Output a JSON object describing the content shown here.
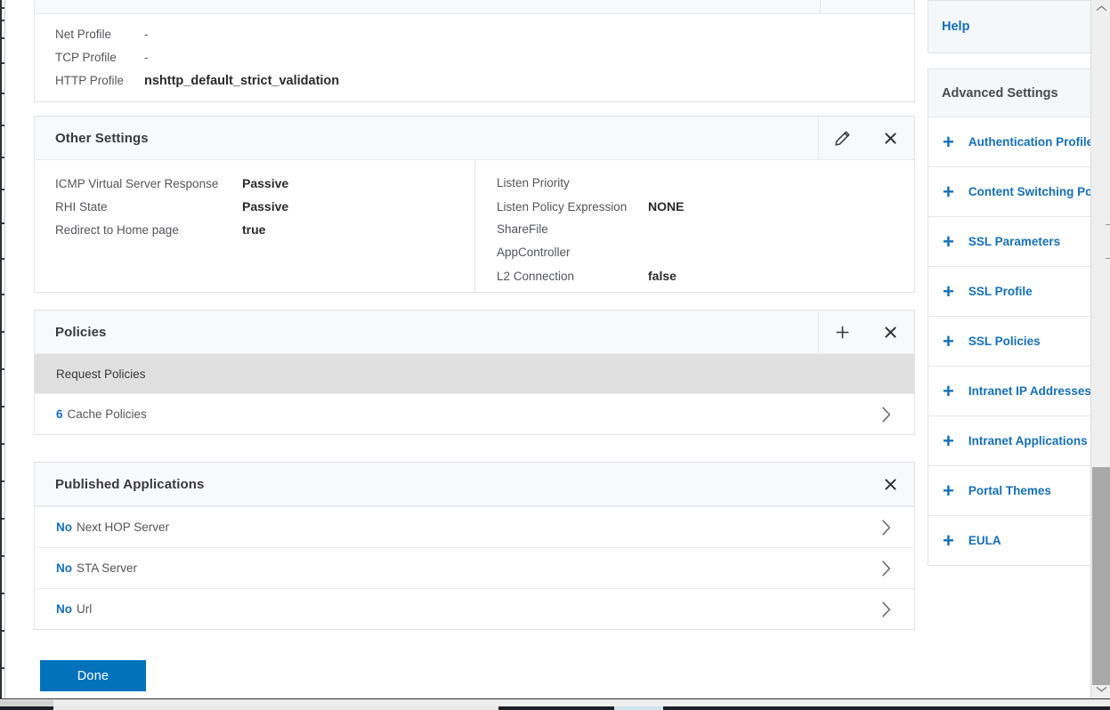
{
  "profile_summary": {
    "rows": [
      {
        "label": "Net Profile",
        "value": "-",
        "bold": false
      },
      {
        "label": "TCP Profile",
        "value": "-",
        "bold": false
      },
      {
        "label": "HTTP Profile",
        "value": "nshttp_default_strict_validation",
        "bold": true
      }
    ]
  },
  "other_settings": {
    "title": "Other Settings",
    "edit_icon": "pencil-icon",
    "close_icon": "close-icon",
    "left_rows": [
      {
        "label": "ICMP Virtual Server Response",
        "value": "Passive"
      },
      {
        "label": "RHI State",
        "value": "Passive"
      },
      {
        "label": "Redirect to Home page",
        "value": "true"
      }
    ],
    "right_rows": [
      {
        "label": "Listen Priority",
        "value": ""
      },
      {
        "label": "Listen Policy Expression",
        "value": "NONE"
      },
      {
        "label": "ShareFile",
        "value": ""
      },
      {
        "label": "AppController",
        "value": ""
      },
      {
        "label": "L2 Connection",
        "value": "false"
      }
    ]
  },
  "policies": {
    "title": "Policies",
    "add_icon": "plus-icon",
    "close_icon": "close-icon",
    "group_label": "Request Policies",
    "rows": [
      {
        "count": "6",
        "label": "Cache Policies",
        "chevron": "chevron-right-icon"
      }
    ]
  },
  "published_applications": {
    "title": "Published Applications",
    "close_icon": "close-icon",
    "rows": [
      {
        "count": "No",
        "label": "Next HOP Server",
        "chevron": "chevron-right-icon"
      },
      {
        "count": "No",
        "label": "STA Server",
        "chevron": "chevron-right-icon"
      },
      {
        "count": "No",
        "label": "Url",
        "chevron": "chevron-right-icon"
      }
    ]
  },
  "footer": {
    "done_label": "Done"
  },
  "sidebar": {
    "help_label": "Help",
    "advanced_title": "Advanced Settings",
    "advanced_items": [
      {
        "plus": "+",
        "label": "Authentication Profile"
      },
      {
        "plus": "+",
        "label": "Content Switching Policies"
      },
      {
        "plus": "+",
        "label": "SSL Parameters"
      },
      {
        "plus": "+",
        "label": "SSL Profile"
      },
      {
        "plus": "+",
        "label": "SSL Policies"
      },
      {
        "plus": "+",
        "label": "Intranet IP Addresses"
      },
      {
        "plus": "+",
        "label": "Intranet Applications"
      },
      {
        "plus": "+",
        "label": "Portal Themes"
      },
      {
        "plus": "+",
        "label": "EULA"
      }
    ]
  },
  "colors": {
    "accent_blue": "#1570b8",
    "button_blue": "#0272bc",
    "card_header_bg": "#f7f9fb",
    "group_row_bg": "#e0e0e0",
    "border": "#dfe3e8",
    "label_gray": "#53565a"
  },
  "scrollbars": {
    "vertical": {
      "up_icon": "chevron-up-icon",
      "down_icon": "chevron-down-icon"
    },
    "horizontal": {}
  }
}
